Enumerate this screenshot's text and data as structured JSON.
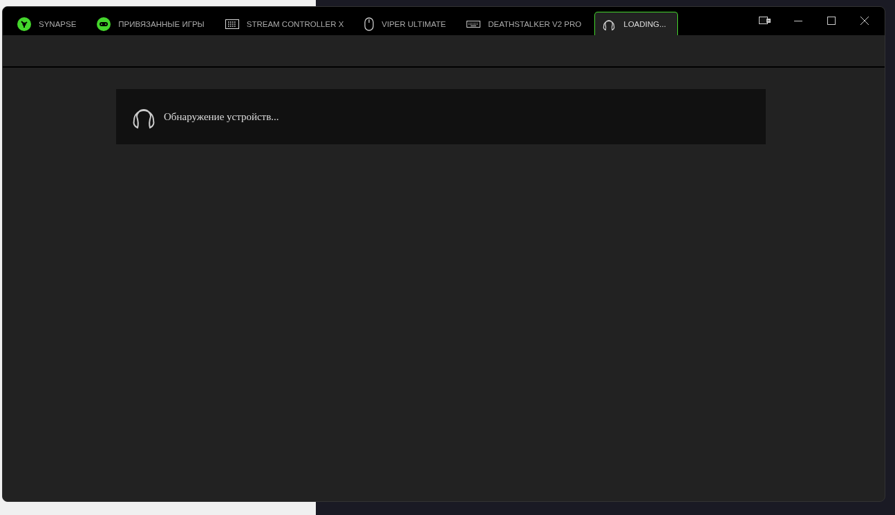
{
  "tabs": [
    {
      "label": "SYNAPSE",
      "kind": "logo",
      "selected": false
    },
    {
      "label": "ПРИВЯЗАННЫЕ ИГРЫ",
      "kind": "gamepad",
      "selected": false
    },
    {
      "label": "STREAM CONTROLLER X",
      "kind": "keypad",
      "selected": false
    },
    {
      "label": "VIPER ULTIMATE",
      "kind": "mouse",
      "selected": false
    },
    {
      "label": "DEATHSTALKER V2 PRO",
      "kind": "keyboard",
      "selected": false
    },
    {
      "label": "LOADING...",
      "kind": "headset",
      "selected": true
    }
  ],
  "status": {
    "message": "Обнаружение устройств..."
  }
}
